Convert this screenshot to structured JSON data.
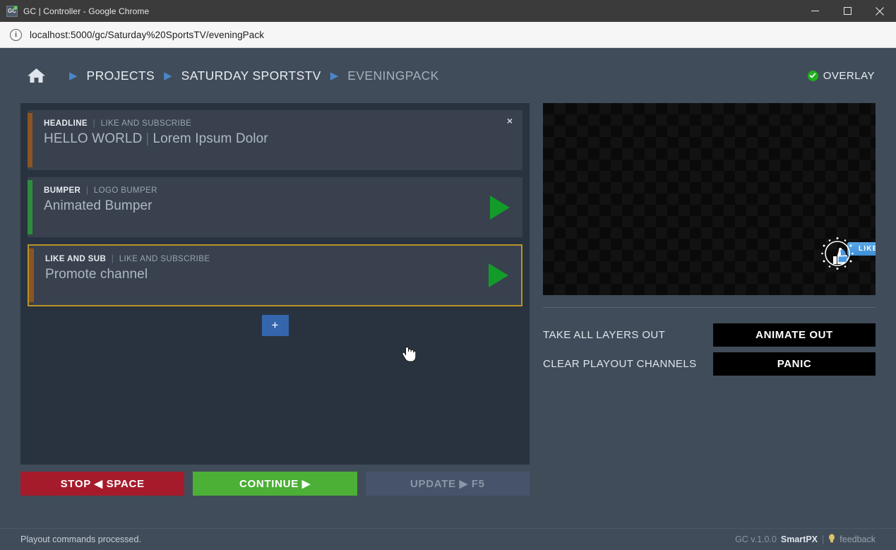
{
  "window": {
    "title": "GC | Controller - Google Chrome",
    "favicon_label": "GC",
    "minimize_label": "Minimize",
    "maximize_label": "Maximize",
    "close_label": "Close"
  },
  "browser": {
    "url": "localhost:5000/gc/Saturday%20SportsTV/eveningPack",
    "info_glyph": "i"
  },
  "header": {
    "home_icon": "home-icon",
    "breadcrumbs": [
      {
        "label": "PROJECTS",
        "current": false
      },
      {
        "label": "SATURDAY SPORTSTV",
        "current": false
      },
      {
        "label": "EVENINGPACK",
        "current": true
      }
    ],
    "separator": "▶",
    "status": {
      "label": "OVERLAY",
      "check_glyph": "✓",
      "color": "#1fb01f"
    }
  },
  "cards": [
    {
      "name": "HEADLINE",
      "pipe": "|",
      "template": "LIKE AND SUBSCRIBE",
      "title_main": "HELLO WORLD",
      "title_pipe": "|",
      "title_sub": "Lorem Ipsum Dolor",
      "accent_color": "#8c5424",
      "selected": false,
      "has_play": false,
      "has_close": true,
      "close_glyph": "×"
    },
    {
      "name": "BUMPER",
      "pipe": "|",
      "template": "LOGO BUMPER",
      "title_main": "Animated Bumper",
      "title_pipe": "",
      "title_sub": "",
      "accent_color": "#2d8c3e",
      "selected": false,
      "has_play": true,
      "has_close": false,
      "close_glyph": ""
    },
    {
      "name": "LIKE AND SUB",
      "pipe": "|",
      "template": "LIKE AND SUBSCRIBE",
      "title_main": "Promote channel",
      "title_pipe": "",
      "title_sub": "",
      "accent_color": "#8c5424",
      "selected": true,
      "selected_border": "#b99329",
      "has_play": true,
      "has_close": false,
      "close_glyph": ""
    }
  ],
  "add_layer": {
    "label": "+",
    "color": "#3566ad"
  },
  "transport": [
    {
      "label": "STOP ◀ SPACE",
      "kind": "stop",
      "color": "#a61b2b",
      "disabled": false
    },
    {
      "label": "CONTINUE ▶",
      "kind": "continue",
      "color": "#4caf36",
      "disabled": false
    },
    {
      "label": "UPDATE ▶ F5",
      "kind": "update",
      "color": "#46536a",
      "disabled": true
    }
  ],
  "preview": {
    "name": "preview-canvas",
    "background": "#0a0a0a",
    "overlay_graphic": {
      "icon": "thumbs-up-icon",
      "badge_text": "LIKE",
      "badge_color": "#4a97de"
    }
  },
  "actions": [
    {
      "label": "TAKE ALL LAYERS OUT",
      "button": "ANIMATE OUT",
      "name": "animate-out"
    },
    {
      "label": "CLEAR PLAYOUT CHANNELS",
      "button": "PANIC",
      "name": "panic"
    }
  ],
  "status_bar": {
    "message": "Playout commands processed.",
    "version": "GC v.1.0.0",
    "brand": "SmartPX",
    "separator": "|",
    "feedback": "feedback",
    "bulb_glyph": "●"
  }
}
